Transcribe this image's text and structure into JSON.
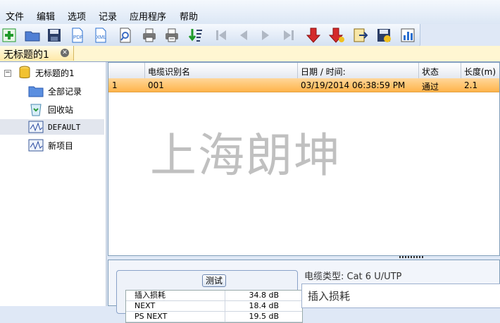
{
  "menu": [
    "文件",
    "编辑",
    "选项",
    "记录",
    "应用程序",
    "帮助"
  ],
  "toolbar": {
    "buttons": [
      {
        "name": "new-icon",
        "color": "#1f9a2a"
      },
      {
        "name": "open-folder-icon",
        "color": "#3b6cc4"
      },
      {
        "name": "save-icon",
        "color": "#2c3e66"
      },
      {
        "name": "pdf-icon",
        "label": "PDF",
        "color": "#2a6fd0"
      },
      {
        "name": "xml-icon",
        "label": "XML",
        "color": "#2a6fd0"
      },
      {
        "name": "find-icon",
        "color": "#3b6cc4"
      },
      {
        "name": "print-icon",
        "color": "#555555"
      },
      {
        "name": "print-preview-icon",
        "color": "#555555"
      },
      {
        "name": "sort-icon",
        "color": "#1f9a2a"
      },
      {
        "name": "first-record-icon",
        "color": "#b0b8c4"
      },
      {
        "name": "previous-record-icon",
        "color": "#b0b8c4"
      },
      {
        "name": "next-record-icon",
        "color": "#b0b8c4"
      },
      {
        "name": "last-record-icon",
        "color": "#b0b8c4"
      },
      {
        "name": "download-icon",
        "color": "#d42a2a"
      },
      {
        "name": "download-all-icon",
        "color": "#d42a2a"
      },
      {
        "name": "export-icon",
        "color": "#c79a1c"
      },
      {
        "name": "import-icon",
        "color": "#c79a1c"
      },
      {
        "name": "bar-chart-icon",
        "color": "#2a6fd0"
      }
    ]
  },
  "tab": {
    "title": "无标题的1"
  },
  "tree": {
    "root": "无标题的1",
    "items": [
      {
        "label": "全部记录",
        "icon": "folder-icon"
      },
      {
        "label": "回收站",
        "icon": "recycle-bin-icon"
      },
      {
        "label": "DEFAULT",
        "icon": "project-icon"
      },
      {
        "label": "新项目",
        "icon": "project-icon"
      }
    ]
  },
  "table": {
    "columns": [
      "电缆识别名",
      "日期 / 时间:",
      "状态",
      "长度(m)"
    ],
    "rows": [
      {
        "index": "1",
        "name": "001",
        "datetime": "03/19/2014  06:38:59 PM",
        "status": "通过",
        "length": "2.1"
      }
    ]
  },
  "watermark": "上海朗坤",
  "bottom": {
    "group_title": "测试",
    "results": [
      {
        "name": "插入损耗",
        "value": "34.8 dB"
      },
      {
        "name": "NEXT",
        "value": "18.4 dB"
      },
      {
        "name": "PS NEXT",
        "value": "19.5 dB"
      }
    ],
    "cable_type": "电缆类型: Cat 6 U/UTP",
    "detail_title": "插入损耗"
  }
}
